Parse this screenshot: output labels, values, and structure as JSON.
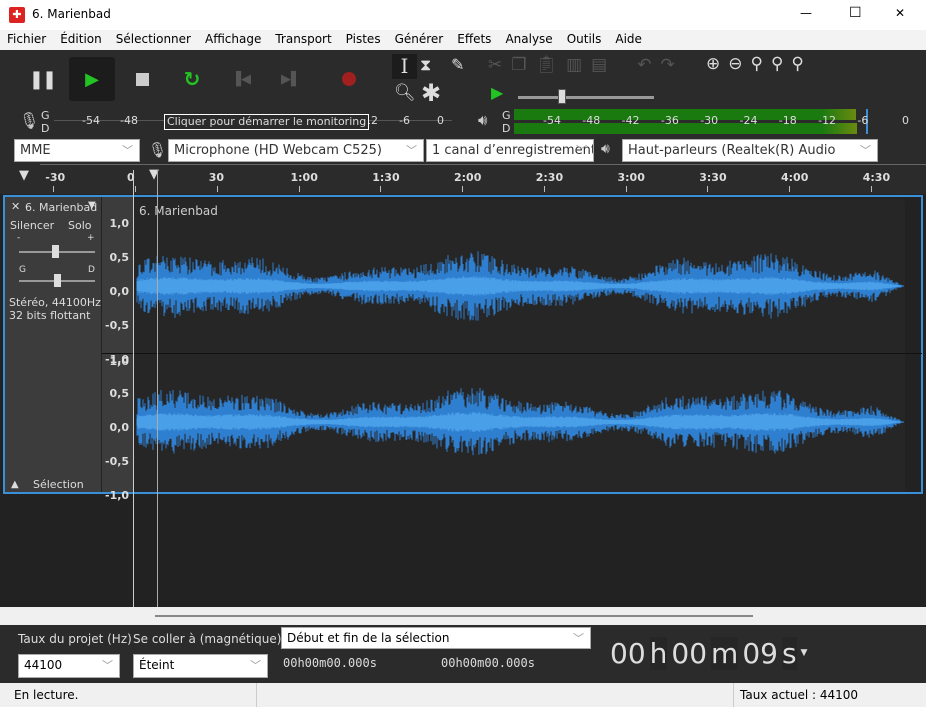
{
  "window": {
    "title": "6. Marienbad",
    "minimize": "—",
    "maximize": "☐",
    "close": "✕"
  },
  "menu": [
    "Fichier",
    "Édition",
    "Sélectionner",
    "Affichage",
    "Transport",
    "Pistes",
    "Générer",
    "Effets",
    "Analyse",
    "Outils",
    "Aide"
  ],
  "transport": {
    "pause": "pause-icon",
    "play": "play-icon",
    "stop": "stop-icon",
    "loop": "loop-icon",
    "skip_start": "skip-start-icon",
    "skip_end": "skip-end-icon",
    "record": "record-icon",
    "play_color": "#22c322",
    "record_color": "#a01f1f"
  },
  "record_meter": {
    "channels": [
      "G",
      "D"
    ],
    "ticks": [
      "-54",
      "-48",
      "",
      "",
      "",
      "",
      "",
      "-12",
      "-6",
      "0"
    ],
    "tooltip": "Cliquer pour démarrer le monitoring"
  },
  "play_meter": {
    "channels": [
      "G",
      "D"
    ],
    "ticks": [
      "-54",
      "-48",
      "-42",
      "-36",
      "-30",
      "-24",
      "-18",
      "-12",
      "-6",
      "0"
    ],
    "level_db": -8,
    "meter_color": "#1a7a10"
  },
  "devices": {
    "host": "MME",
    "input": "Microphone (HD Webcam C525)",
    "channels": "1 canal d’enregistrement",
    "output": "Haut-parleurs (Realtek(R) Audio"
  },
  "timeline": {
    "ticks": [
      "-30",
      "0",
      "30",
      "1:00",
      "1:30",
      "2:00",
      "2:30",
      "3:00",
      "3:30",
      "4:00",
      "4:30"
    ],
    "play_position_s": 9
  },
  "track": {
    "name": "6. Marienbad",
    "mute": "Silencer",
    "solo": "Solo",
    "gain_minus": "-",
    "gain_plus": "+",
    "pan_left": "G",
    "pan_right": "D",
    "info1": "Stéréo, 44100Hz",
    "info2": "32 bits flottant",
    "select": "Sélection",
    "clip_name": "6. Marienbad",
    "scale": [
      "1,0",
      "0,5",
      "0,0",
      "-0,5",
      "-1,0"
    ],
    "wave_color": "#2f7fd0",
    "wave_rms_color": "#4aa0e8"
  },
  "bottom": {
    "rate_label": "Taux du projet (Hz)",
    "snap_label": "Se coller à (magnétique)",
    "selection_mode": "Début et fin de la sélection",
    "rate": "44100",
    "snap": "Éteint",
    "sel_start": "00h00m00.000s",
    "sel_end": "00h00m00.000s",
    "time": {
      "h": "00",
      "m": "00",
      "s": "09"
    },
    "h": "h",
    "mm": "m",
    "ss": "s"
  },
  "status": {
    "left": "En lecture.",
    "right": "Taux actuel : 44100"
  }
}
